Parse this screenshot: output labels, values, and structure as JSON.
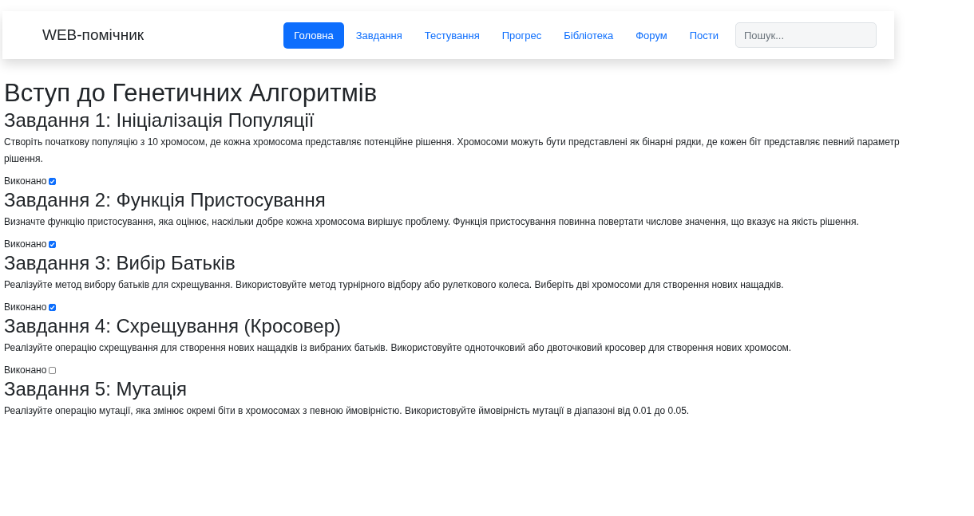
{
  "navbar": {
    "brand": "WEB-помічник",
    "links": [
      {
        "label": "Головна",
        "selected": true
      },
      {
        "label": "Завдання",
        "selected": false
      },
      {
        "label": "Тестування",
        "selected": false
      },
      {
        "label": "Прогрес",
        "selected": false
      },
      {
        "label": "Бібліотека",
        "selected": false
      },
      {
        "label": "Форум",
        "selected": false
      },
      {
        "label": "Пости",
        "selected": false
      }
    ],
    "search": {
      "placeholder": "Пошук..."
    }
  },
  "page_title": "Вступ до Генетичних Алгоритмів",
  "tasks": [
    {
      "title": "Завдання 1: Ініціалізація Популяції",
      "description": "Створіть початкову популяцію з 10 хромосом, де кожна хромосома представляє потенційне рішення. Хромосоми можуть бути представлені як бінарні рядки, де кожен біт представляє певний параметр рішення.",
      "done_label": "Виконано",
      "checked": true
    },
    {
      "title": "Завдання 2: Функція Пристосування",
      "description": "Визначте функцію пристосування, яка оцінює, наскільки добре кожна хромосома вирішує проблему. Функція пристосування повинна повертати числове значення, що вказує на якість рішення.",
      "done_label": "Виконано",
      "checked": true
    },
    {
      "title": "Завдання 3: Вибір Батьків",
      "description": "Реалізуйте метод вибору батьків для схрещування. Використовуйте метод турнірного відбору або рулеткового колеса. Виберіть дві хромосоми для створення нових нащадків.",
      "done_label": "Виконано",
      "checked": true
    },
    {
      "title": "Завдання 4: Схрещування (Кросовер)",
      "description": "Реалізуйте операцію схрещування для створення нових нащадків із вибраних батьків. Використовуйте одноточковий або двоточковий кросовер для створення нових хромосом.",
      "done_label": "Виконано",
      "checked": false
    },
    {
      "title": "Завдання 5: Мутація",
      "description": "Реалізуйте операцію мутації, яка змінює окремі біти в хромосомах з певною ймовірністю. Використовуйте ймовірність мутації в діапазоні від 0.01 до 0.05."
    }
  ]
}
